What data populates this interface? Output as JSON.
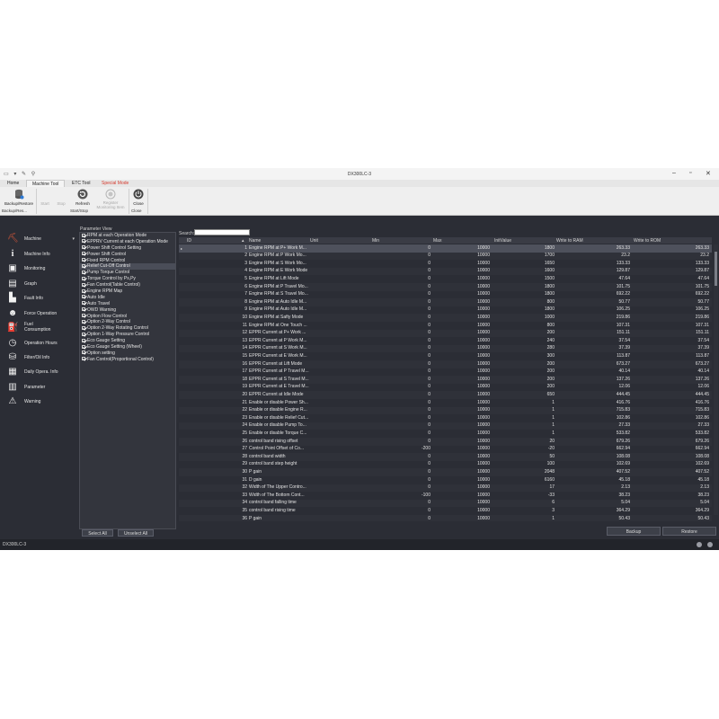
{
  "window": {
    "title": "DX300LC-3"
  },
  "ribbon": {
    "tabs": [
      "Home",
      "Machine Tool",
      "ETC Tool",
      "Special Mode"
    ],
    "buttons": [
      {
        "label": "Backup/Restore"
      },
      {
        "label": "Start"
      },
      {
        "label": "Stop"
      },
      {
        "label": "Refresh"
      },
      {
        "label": "Register Monitoring Item"
      },
      {
        "label": "Close"
      }
    ],
    "groups": [
      "Backup/Res...",
      "Start/Stop",
      "Close"
    ]
  },
  "sidebar": {
    "items": [
      {
        "label": "Machine",
        "icon": "excavator-icon"
      },
      {
        "label": "Machine Info",
        "icon": "info-icon"
      },
      {
        "label": "Monitoring",
        "icon": "monitor-icon"
      },
      {
        "label": "Graph",
        "icon": "graph-icon"
      },
      {
        "label": "Fault Info",
        "icon": "fault-chart-icon"
      },
      {
        "label": "Force Operation",
        "icon": "person-icon"
      },
      {
        "label": "Fuel Consumption",
        "icon": "fuel-icon"
      },
      {
        "label": "Operation Hours",
        "icon": "clock-icon"
      },
      {
        "label": "Filter/Oil Info",
        "icon": "filter-icon"
      },
      {
        "label": "Daily Opera. Info",
        "icon": "calendar-icon"
      },
      {
        "label": "Parameter",
        "icon": "clipboard-icon"
      },
      {
        "label": "Warning",
        "icon": "warning-icon"
      }
    ]
  },
  "parameter_view": {
    "title": "Parameter View",
    "items": [
      "RPM at each Operation Mode",
      "EPPRV Current at each Operation Mode",
      "Power Shift Control Setting",
      "Power Shift Control",
      "Fixed RPM Control",
      "Relief Cut-Off Control",
      "Pump Torque Control",
      "Torque Control by Ps,Py",
      "Fan Control(Table Control)",
      "Engine RPM Map",
      "Auto Idle",
      "Auto Travel",
      "OWD Warning",
      "Option Flow Control",
      "Option 2-Way Control",
      "Option 2-Way Rotating Control",
      "Option 1-Way Pressure Control",
      "Eco Gauge Setting",
      "Eco Gauge Setting (Wheel)",
      "Option setting",
      "Fan Control(Proportional Control)"
    ],
    "select_all": "Select All",
    "unselect_all": "Unselect All"
  },
  "search": {
    "label": "Search:",
    "value": ""
  },
  "table": {
    "columns": [
      "ID",
      "Name",
      "Unit",
      "Min",
      "Max",
      "InitValue",
      "Write to RAM",
      "Write to ROM"
    ],
    "rows": [
      [
        "1",
        "Engine RPM at P+ Work M...",
        "",
        "0",
        "10000",
        "1800",
        "263.33",
        "263.33"
      ],
      [
        "2",
        "Engine RPM at P Work Mo...",
        "",
        "0",
        "10000",
        "1700",
        "23.2",
        "23.2"
      ],
      [
        "3",
        "Engine RPM at S Work Mo...",
        "",
        "0",
        "10000",
        "1650",
        "133.33",
        "133.33"
      ],
      [
        "4",
        "Engine RPM at E Work Mode",
        "",
        "0",
        "10000",
        "1600",
        "129.87",
        "129.87"
      ],
      [
        "5",
        "Engine RPM at Lift Mode",
        "",
        "0",
        "10000",
        "1500",
        "47.64",
        "47.64"
      ],
      [
        "6",
        "Engine RPM at P Travel Mo...",
        "",
        "0",
        "10000",
        "1800",
        "101.75",
        "101.75"
      ],
      [
        "7",
        "Engine RPM at S Travel Mo...",
        "",
        "0",
        "10000",
        "1800",
        "692.22",
        "692.22"
      ],
      [
        "8",
        "Engine RPM at Auto Idle M...",
        "",
        "0",
        "10000",
        "800",
        "50.77",
        "50.77"
      ],
      [
        "9",
        "Engine RPM at Auto Idle M...",
        "",
        "0",
        "10000",
        "1800",
        "106.25",
        "106.25"
      ],
      [
        "10",
        "Engine RPM at Safty Mode",
        "",
        "0",
        "10000",
        "1000",
        "219.86",
        "219.86"
      ],
      [
        "11",
        "Engine RPM at One Touch ...",
        "",
        "0",
        "10000",
        "800",
        "107.31",
        "107.31"
      ],
      [
        "12",
        "EPPR Current at P+ Work ...",
        "",
        "0",
        "10000",
        "200",
        "151.11",
        "151.11"
      ],
      [
        "13",
        "EPPR Current at P Work M...",
        "",
        "0",
        "10000",
        "240",
        "37.54",
        "37.54"
      ],
      [
        "14",
        "EPPR Current at S Work M...",
        "",
        "0",
        "10000",
        "280",
        "37.39",
        "37.39"
      ],
      [
        "15",
        "EPPR Current at E Work M...",
        "",
        "0",
        "10000",
        "300",
        "113.87",
        "113.87"
      ],
      [
        "16",
        "EPPR Current at Lift Mode",
        "",
        "0",
        "10000",
        "200",
        "673.27",
        "673.27"
      ],
      [
        "17",
        "EPPR Current at P Travel M...",
        "",
        "0",
        "10000",
        "200",
        "40.14",
        "40.14"
      ],
      [
        "18",
        "EPPR Current at S Travel M...",
        "",
        "0",
        "10000",
        "200",
        "137.26",
        "137.26"
      ],
      [
        "19",
        "EPPR Current at E Travel M...",
        "",
        "0",
        "10000",
        "200",
        "12.06",
        "12.06"
      ],
      [
        "20",
        "EPPR Current at Idle Mode",
        "",
        "0",
        "10000",
        "650",
        "444.45",
        "444.45"
      ],
      [
        "21",
        "Enable or disable Power Sh...",
        "",
        "0",
        "10000",
        "1",
        "416.76",
        "416.76"
      ],
      [
        "22",
        "Enable or disable Engine R...",
        "",
        "0",
        "10000",
        "1",
        "715.83",
        "715.83"
      ],
      [
        "23",
        "Enable or disable Relief Cut...",
        "",
        "0",
        "10000",
        "1",
        "102.86",
        "102.86"
      ],
      [
        "24",
        "Enable or disable Pump To...",
        "",
        "0",
        "10000",
        "1",
        "27.33",
        "27.33"
      ],
      [
        "25",
        "Enable or disable Torque C...",
        "",
        "0",
        "10000",
        "1",
        "533.82",
        "533.82"
      ],
      [
        "26",
        "control band rising offset",
        "",
        "0",
        "10000",
        "20",
        "679.26",
        "679.26"
      ],
      [
        "27",
        "Control Point Offset of Co...",
        "",
        "-200",
        "10000",
        "-20",
        "662.94",
        "662.94"
      ],
      [
        "28",
        "control band width",
        "",
        "0",
        "10000",
        "50",
        "108.08",
        "108.08"
      ],
      [
        "29",
        "control band step height",
        "",
        "0",
        "10000",
        "100",
        "102.69",
        "102.69"
      ],
      [
        "30",
        "P gain",
        "",
        "0",
        "10000",
        "2048",
        "407.52",
        "407.52"
      ],
      [
        "31",
        "D gain",
        "",
        "0",
        "10000",
        "6160",
        "45.18",
        "45.18"
      ],
      [
        "32",
        "Width of The Upper Contro...",
        "",
        "0",
        "10000",
        "17",
        "2.13",
        "2.13"
      ],
      [
        "33",
        "Width of The Bottom Cont...",
        "",
        "-100",
        "10000",
        "-33",
        "38.23",
        "38.23"
      ],
      [
        "34",
        "control band falling time",
        "",
        "0",
        "10000",
        "6",
        "5.04",
        "5.04"
      ],
      [
        "35",
        "control band rising time",
        "",
        "0",
        "10000",
        "3",
        "364.29",
        "364.29"
      ],
      [
        "36",
        "P gain",
        "",
        "0",
        "10000",
        "1",
        "50.43",
        "50.43"
      ]
    ]
  },
  "actions": {
    "backup": "Backup",
    "restore": "Restore"
  },
  "status": {
    "text": "DX300LC-3"
  }
}
